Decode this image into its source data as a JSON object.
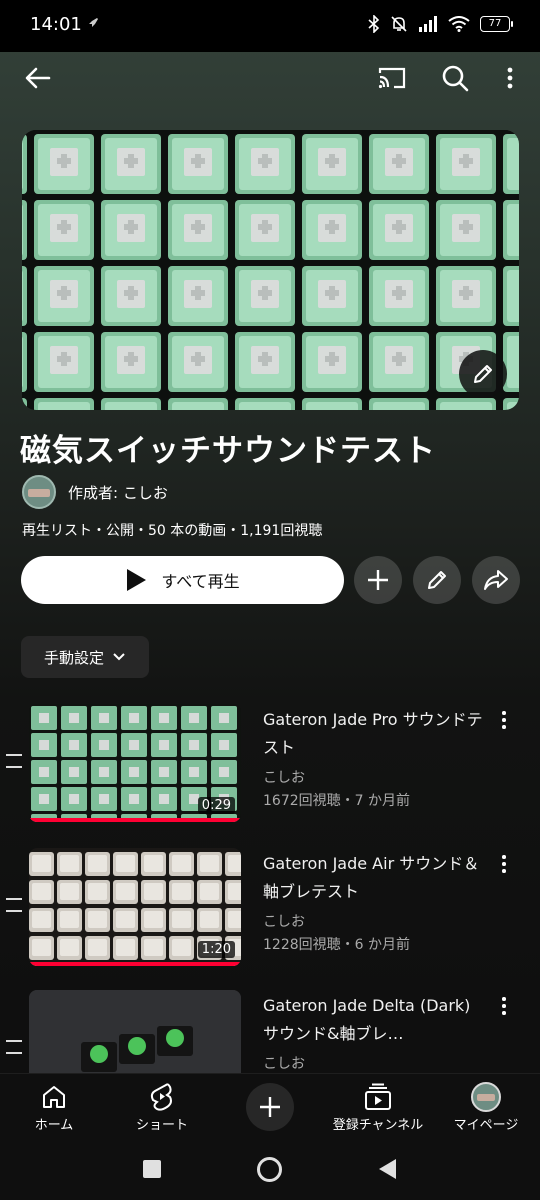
{
  "status_bar": {
    "time": "14:01",
    "battery": "77"
  },
  "top_bar": {
    "icons": [
      "back-arrow-icon",
      "cast-icon",
      "search-icon",
      "more-vert-icon"
    ]
  },
  "playlist": {
    "title": "磁気スイッチサウンドテスト",
    "author": "作成者: こしお",
    "meta": "再生リスト・公開・50 本の動画・1,191回視聴",
    "play_all_label": "すべて再生",
    "sort_label": "手動設定"
  },
  "videos": [
    {
      "title": "Gateron Jade Pro サウンドテスト",
      "channel": "こしお",
      "stats": "1672回視聴・7 か月前",
      "duration": "0:29"
    },
    {
      "title": "Gateron Jade Air サウンド＆軸ブレテスト",
      "channel": "こしお",
      "stats": "1228回視聴・6 か月前",
      "duration": "1:20"
    },
    {
      "title": "Gateron Jade Delta (Dark) サウンド&軸ブレ…",
      "channel": "こしお",
      "stats": "",
      "duration": ""
    }
  ],
  "bottom_nav": {
    "home": "ホーム",
    "shorts": "ショート",
    "subscriptions": "登録チャンネル",
    "you": "マイページ"
  },
  "colors": {
    "accent": "#ff0033",
    "background": "#0f0f0f",
    "switch_green": "#8fc9a8"
  }
}
